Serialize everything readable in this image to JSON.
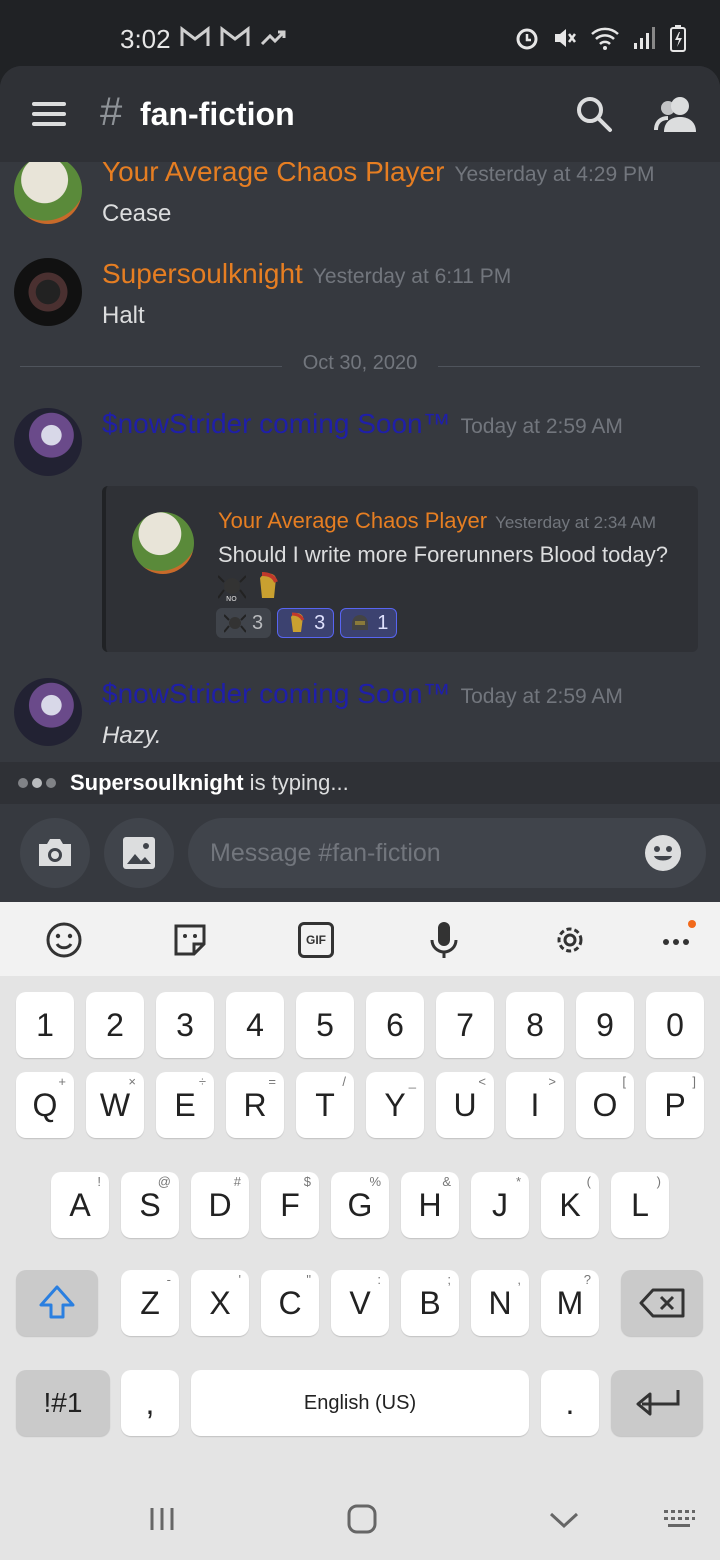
{
  "status_bar": {
    "time": "3:02",
    "notification_icons": [
      "gmail-icon",
      "gmail-icon",
      "trending-icon"
    ],
    "right_icons": [
      "alarm-icon",
      "mute-icon",
      "wifi-icon",
      "signal-icon",
      "battery-icon"
    ]
  },
  "header": {
    "hash": "#",
    "channel": "fan-fiction"
  },
  "messages": [
    {
      "author": "Your Average Chaos Player",
      "author_color": "#e67e22",
      "timestamp": "Yesterday at 4:29 PM",
      "text": "Cease"
    },
    {
      "author": "Supersoulknight",
      "author_color": "#e67e22",
      "timestamp": "Yesterday at 6:11 PM",
      "text": "Halt"
    },
    {
      "author": "$nowStrider coming Soon™",
      "author_color": "#1f1fa8",
      "timestamp": "Today at 2:59 AM",
      "text": ""
    },
    {
      "author": "$nowStrider coming Soon™",
      "author_color": "#1f1fa8",
      "timestamp": "Today at 2:59 AM",
      "text": "Hazy."
    }
  ],
  "date_divider": "Oct 30, 2020",
  "embed": {
    "author": "Your Average Chaos Player",
    "timestamp": "Yesterday at 2:34 AM",
    "text": "Should I write more Forerunners Blood today?",
    "reactions": [
      {
        "emoji": "spider-emoji",
        "count": "3",
        "active": false
      },
      {
        "emoji": "spartan-emoji",
        "count": "3",
        "active": true
      },
      {
        "emoji": "helmet-emoji",
        "count": "1",
        "active": true
      }
    ]
  },
  "typing": {
    "user": "Supersoulknight",
    "suffix": " is typing..."
  },
  "composer": {
    "placeholder": "Message #fan-fiction"
  },
  "keyboard": {
    "toolbar": [
      "emoji-icon",
      "sticker-icon",
      "gif-icon",
      "mic-icon",
      "settings-icon",
      "more-icon"
    ],
    "gif_label": "GIF",
    "number_row": [
      "1",
      "2",
      "3",
      "4",
      "5",
      "6",
      "7",
      "8",
      "9",
      "0"
    ],
    "row1": [
      {
        "k": "Q",
        "s": "+"
      },
      {
        "k": "W",
        "s": "×"
      },
      {
        "k": "E",
        "s": "÷"
      },
      {
        "k": "R",
        "s": "="
      },
      {
        "k": "T",
        "s": "/"
      },
      {
        "k": "Y",
        "s": "_"
      },
      {
        "k": "U",
        "s": "<"
      },
      {
        "k": "I",
        "s": ">"
      },
      {
        "k": "O",
        "s": "["
      },
      {
        "k": "P",
        "s": "]"
      }
    ],
    "row2": [
      {
        "k": "A",
        "s": "!"
      },
      {
        "k": "S",
        "s": "@"
      },
      {
        "k": "D",
        "s": "#"
      },
      {
        "k": "F",
        "s": "$"
      },
      {
        "k": "G",
        "s": "%"
      },
      {
        "k": "H",
        "s": "&"
      },
      {
        "k": "J",
        "s": "*"
      },
      {
        "k": "K",
        "s": "("
      },
      {
        "k": "L",
        "s": ")"
      }
    ],
    "row3": [
      {
        "k": "Z",
        "s": "-"
      },
      {
        "k": "X",
        "s": "'"
      },
      {
        "k": "C",
        "s": "\""
      },
      {
        "k": "V",
        "s": ":"
      },
      {
        "k": "B",
        "s": ";"
      },
      {
        "k": "N",
        "s": ","
      },
      {
        "k": "M",
        "s": "?"
      }
    ],
    "symbols_label": "!#1",
    "comma": ",",
    "space_label": "English (US)",
    "period": "."
  },
  "colors": {
    "accent_orange": "#e67e22",
    "embed_orange": "#e67e22",
    "blurple": "#5865f2"
  }
}
